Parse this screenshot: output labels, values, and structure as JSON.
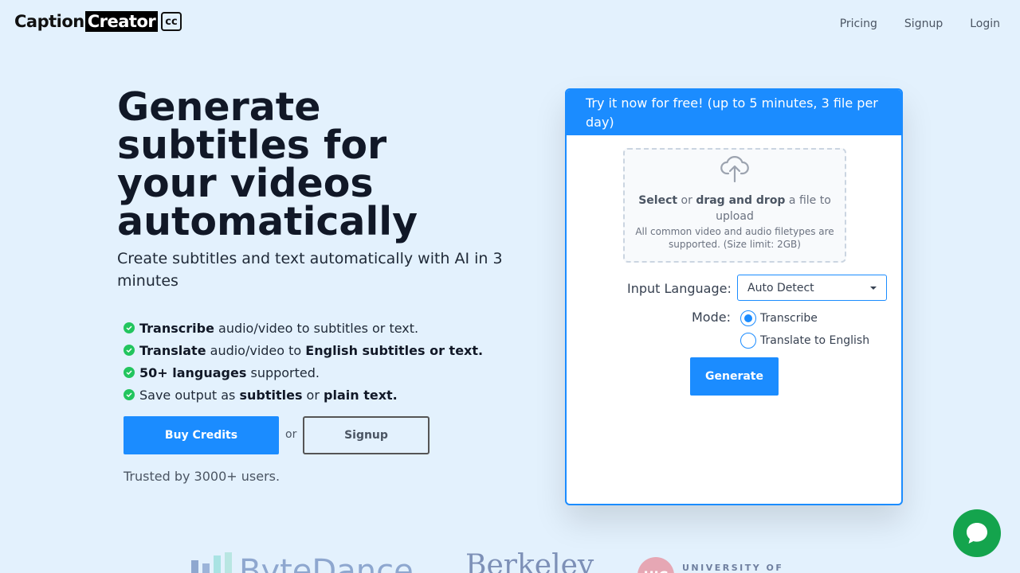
{
  "header": {
    "logo_caption": "Caption",
    "logo_creator": "Creator",
    "logo_cc": "cc",
    "nav": [
      {
        "label": "Pricing"
      },
      {
        "label": "Signup"
      },
      {
        "label": "Login"
      }
    ]
  },
  "hero": {
    "title": "Generate subtitles for your videos automatically",
    "subtitle": "Create subtitles and text automatically with AI in 3 minutes",
    "features": [
      {
        "b1": "Transcribe",
        "t1": " audio/video to subtitles or text.",
        "b2": "",
        "t2": ""
      },
      {
        "b1": "Translate",
        "t1": " audio/video to ",
        "b2": "English subtitles or text.",
        "t2": ""
      },
      {
        "b1": "50+ languages",
        "t1": " supported.",
        "b2": "",
        "t2": ""
      },
      {
        "b1": "",
        "t1": "Save output as ",
        "b2": "subtitles",
        "t2": " or "
      },
      {
        "b3": "plain text."
      }
    ],
    "buy_label": "Buy Credits",
    "or_label": "or",
    "signup_label": "Signup",
    "trusted": "Trusted by 3000+ users."
  },
  "card": {
    "header": "Try it now for free! (up to 5 minutes, 3 file per day)",
    "dz_select": "Select",
    "dz_or": " or ",
    "dz_drag": "drag and drop",
    "dz_rest": " a file to upload",
    "dz_note": "All common video and audio filetypes are supported. (Size limit: 2GB)",
    "lang_label": "Input Language:",
    "lang_value": "Auto Detect",
    "mode_label": "Mode:",
    "mode_options": [
      {
        "label": "Transcribe",
        "selected": true
      },
      {
        "label": "Translate to English",
        "selected": false
      }
    ],
    "generate_label": "Generate"
  },
  "logos": {
    "bytedance": "ByteDance",
    "berkeley": "Berkeley",
    "uic_mark": "UIC",
    "uic_text": "UNIVERSITY OF"
  },
  "colors": {
    "accent": "#1b8cff",
    "check": "#22c55e",
    "chat": "#14a44d",
    "background": "#e3f1fd"
  }
}
